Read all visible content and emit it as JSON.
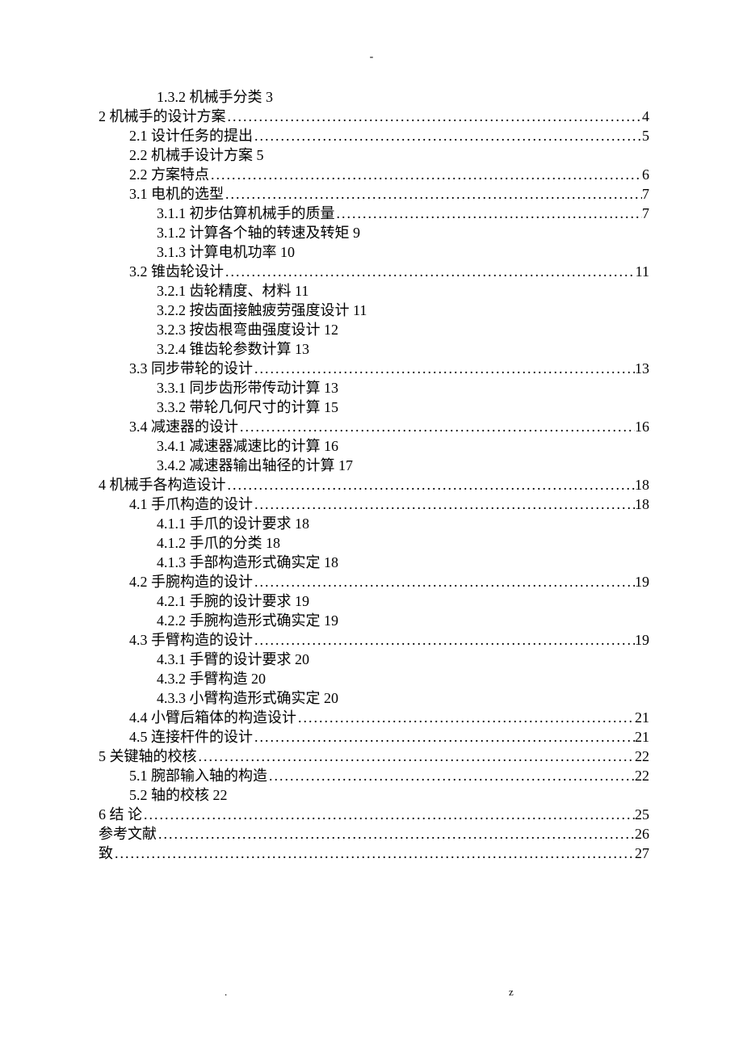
{
  "header_mark": "-",
  "footer": {
    "left": ".",
    "right": "z"
  },
  "toc": [
    {
      "level": 2,
      "label": "1.3.2 机械手分类 3",
      "page": "",
      "dots": false
    },
    {
      "level": 0,
      "label": "2 机械手的设计方案",
      "page": "4",
      "dots": true
    },
    {
      "level": 1,
      "label": "2.1 设计任务的提出",
      "page": "5",
      "dots": true
    },
    {
      "level": 1,
      "label": "2.2 机械手设计方案 5",
      "page": "",
      "dots": false
    },
    {
      "level": 1,
      "label": "2.2 方案特点",
      "page": "6",
      "dots": true
    },
    {
      "level": 1,
      "label": "3.1 电机的选型",
      "page": "7",
      "dots": true
    },
    {
      "level": 2,
      "label": "3.1.1 初步估算机械手的质量",
      "page": "7",
      "dots": true
    },
    {
      "level": 2,
      "label": "3.1.2 计算各个轴的转速及转矩 9",
      "page": "",
      "dots": false
    },
    {
      "level": 2,
      "label": "3.1.3 计算电机功率 10",
      "page": "",
      "dots": false
    },
    {
      "level": 1,
      "label": "3.2 锥齿轮设计",
      "page": "11",
      "dots": true
    },
    {
      "level": 2,
      "label": "3.2.1 齿轮精度、材料 11",
      "page": "",
      "dots": false
    },
    {
      "level": 2,
      "label": "3.2.2 按齿面接触疲劳强度设计 11",
      "page": "",
      "dots": false
    },
    {
      "level": 2,
      "label": "3.2.3 按齿根弯曲强度设计 12",
      "page": "",
      "dots": false
    },
    {
      "level": 2,
      "label": "3.2.4 锥齿轮参数计算 13",
      "page": "",
      "dots": false
    },
    {
      "level": 1,
      "label": "3.3 同步带轮的设计",
      "page": "13",
      "dots": true
    },
    {
      "level": 2,
      "label": "3.3.1 同步齿形带传动计算 13",
      "page": "",
      "dots": false
    },
    {
      "level": 2,
      "label": "3.3.2 带轮几何尺寸的计算 15",
      "page": "",
      "dots": false
    },
    {
      "level": 1,
      "label": "3.4 减速器的设计",
      "page": "16",
      "dots": true
    },
    {
      "level": 2,
      "label": "3.4.1 减速器减速比的计算 16",
      "page": "",
      "dots": false
    },
    {
      "level": 2,
      "label": "3.4.2 减速器输出轴径的计算 17",
      "page": "",
      "dots": false
    },
    {
      "level": 0,
      "label": "4 机械手各构造设计",
      "page": "18",
      "dots": true
    },
    {
      "level": 1,
      "label": "4.1 手爪构造的设计",
      "page": "18",
      "dots": true
    },
    {
      "level": 2,
      "label": "4.1.1 手爪的设计要求 18",
      "page": "",
      "dots": false
    },
    {
      "level": 2,
      "label": "4.1.2 手爪的分类 18",
      "page": "",
      "dots": false
    },
    {
      "level": 2,
      "label": "4.1.3 手部构造形式确实定 18",
      "page": "",
      "dots": false
    },
    {
      "level": 1,
      "label": "4.2 手腕构造的设计",
      "page": "19",
      "dots": true
    },
    {
      "level": 2,
      "label": "4.2.1 手腕的设计要求 19",
      "page": "",
      "dots": false
    },
    {
      "level": 2,
      "label": "4.2.2 手腕构造形式确实定 19",
      "page": "",
      "dots": false
    },
    {
      "level": 1,
      "label": "4.3 手臂构造的设计",
      "page": "19",
      "dots": true
    },
    {
      "level": 2,
      "label": "4.3.1 手臂的设计要求 20",
      "page": "",
      "dots": false
    },
    {
      "level": 2,
      "label": "4.3.2 手臂构造 20",
      "page": "",
      "dots": false
    },
    {
      "level": 2,
      "label": "4.3.3 小臂构造形式确实定 20",
      "page": "",
      "dots": false
    },
    {
      "level": 1,
      "label": "4.4 小臂后箱体的构造设计",
      "page": "21",
      "dots": true
    },
    {
      "level": 1,
      "label": "4.5 连接杆件的设计",
      "page": "21",
      "dots": true
    },
    {
      "level": 0,
      "label": "5 关键轴的校核",
      "page": "22",
      "dots": true
    },
    {
      "level": 1,
      "label": "5.1 腕部输入轴的构造",
      "page": "22",
      "dots": true
    },
    {
      "level": 1,
      "label": "5.2 轴的校核 22",
      "page": "",
      "dots": false
    },
    {
      "level": 0,
      "label": "6 结      论",
      "page": "25",
      "dots": true
    },
    {
      "level": 0,
      "label": "参考文献",
      "page": "26",
      "dots": true
    },
    {
      "level": 0,
      "label": "致",
      "page": "27",
      "dots": true
    }
  ]
}
